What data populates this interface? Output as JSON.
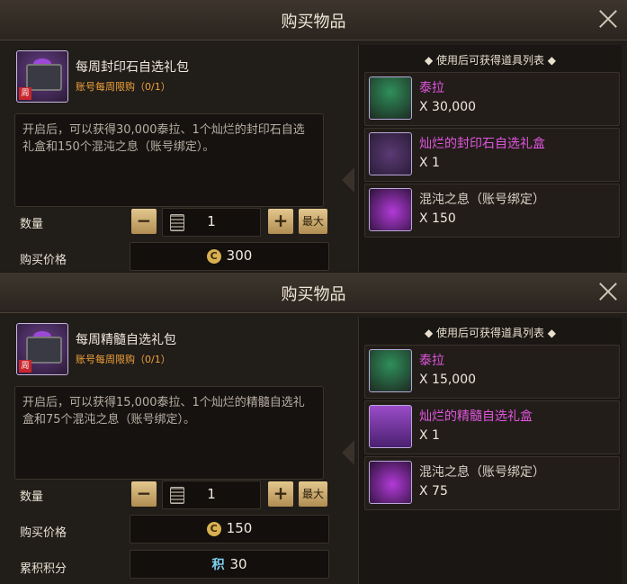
{
  "panels": [
    {
      "title": "购买物品",
      "package_name": "每周封印石自选礼包",
      "limit": "账号每周限购（0/1）",
      "description": "开启后，可以获得30,000泰拉、1个灿烂的封印石自选礼盒和150个混沌之息（账号绑定）。",
      "quantity_label": "数量",
      "quantity": "1",
      "max_label": "最大",
      "price_label": "购买价格",
      "price": "300",
      "list_header": "◆ 使用后可获得道具列表 ◆",
      "items": [
        {
          "name": "泰拉",
          "qty": "X 30,000",
          "color": "#e255e0"
        },
        {
          "name": "灿烂的封印石自选礼盒",
          "qty": "X 1",
          "color": "#e255e0"
        },
        {
          "name": "混沌之息（账号绑定）",
          "qty": "X 150",
          "color": "#d7cfc3"
        }
      ]
    },
    {
      "title": "购买物品",
      "package_name": "每周精髓自选礼包",
      "limit": "账号每周限购（0/1）",
      "description": "开启后，可以获得15,000泰拉、1个灿烂的精髓自选礼盒和75个混沌之息（账号绑定）。",
      "quantity_label": "数量",
      "quantity": "1",
      "max_label": "最大",
      "price_label": "购买价格",
      "price": "150",
      "points_label": "累积积分",
      "points_icon": "积",
      "points": "30",
      "list_header": "◆ 使用后可获得道具列表 ◆",
      "items": [
        {
          "name": "泰拉",
          "qty": "X 15,000",
          "color": "#e255e0"
        },
        {
          "name": "灿烂的精髓自选礼盒",
          "qty": "X 1",
          "color": "#e255e0"
        },
        {
          "name": "混沌之息（账号绑定）",
          "qty": "X 75",
          "color": "#d7cfc3"
        }
      ]
    }
  ],
  "icons": {
    "close": "close-icon",
    "calculator": "calculator-icon",
    "currency": "coin-icon",
    "package": "gift-chest-icon"
  },
  "colors": {
    "accent_gold": "#d4b273",
    "limit_orange": "#f0a23b",
    "item_pink": "#e255e0"
  }
}
